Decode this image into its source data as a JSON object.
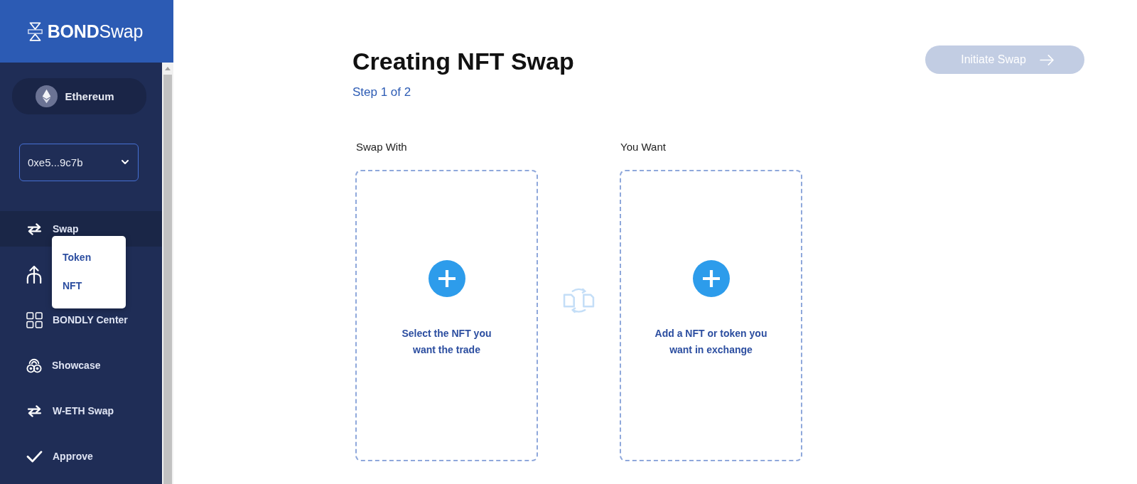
{
  "sidebar": {
    "logo": "**BOND**Swap",
    "network": {
      "label": "Ethereum"
    },
    "account": {
      "value": "0xe5...9c7b"
    },
    "nav": [
      {
        "label": "Swap",
        "selected": true,
        "submenu": [
          "Token",
          "NFT"
        ]
      },
      {
        "selected": false
      },
      {
        "label": "BONDLY Center",
        "selected": false
      },
      {
        "label": "Showcase",
        "selected": false
      },
      {
        "label": "W-ETH Swap",
        "selected": false
      },
      {
        "label": "Approve",
        "selected": false
      }
    ]
  },
  "main": {
    "title": "Creating NFT Swap",
    "step": "Step 1 of 2",
    "initiate_button": {
      "label": "Initiate Swap",
      "disabled": true
    },
    "panels": [
      {
        "heading": "Swap With",
        "hint_lines": [
          "Select the NFT you",
          "want the trade"
        ]
      },
      {
        "heading": "You Want",
        "hint_lines": [
          "Add a NFT or token you",
          "want in exchange"
        ]
      }
    ]
  }
}
